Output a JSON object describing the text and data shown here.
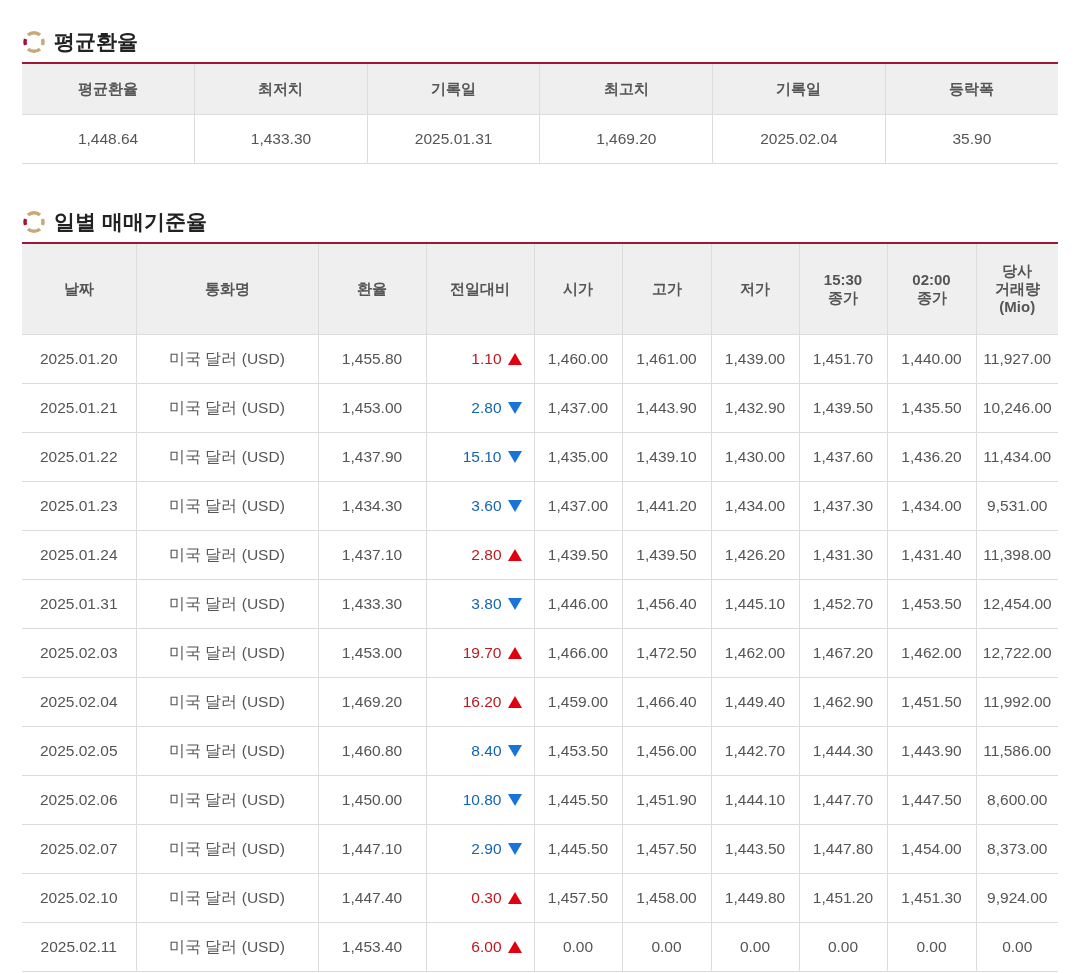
{
  "average_section": {
    "title": "평균환율",
    "columns": [
      "평균환율",
      "최저치",
      "기록일",
      "최고치",
      "기록일",
      "등락폭"
    ],
    "values": [
      "1,448.64",
      "1,433.30",
      "2025.01.31",
      "1,469.20",
      "2025.02.04",
      "35.90"
    ]
  },
  "daily_section": {
    "title": "일별 매매기준율",
    "columns": [
      "날짜",
      "통화명",
      "환율",
      "전일대비",
      "시가",
      "고가",
      "저가",
      "15:30\n종가",
      "02:00\n종가",
      "당사\n거래량\n(Mio)"
    ],
    "rows": [
      {
        "date": "2025.01.20",
        "currency": "미국 달러 (USD)",
        "rate": "1,455.80",
        "change": "1.10",
        "rising": true,
        "open": "1,460.00",
        "high": "1,461.00",
        "low": "1,439.00",
        "close_1530": "1,451.70",
        "close_0200": "1,440.00",
        "volume": "11,927.00"
      },
      {
        "date": "2025.01.21",
        "currency": "미국 달러 (USD)",
        "rate": "1,453.00",
        "change": "2.80",
        "rising": false,
        "open": "1,437.00",
        "high": "1,443.90",
        "low": "1,432.90",
        "close_1530": "1,439.50",
        "close_0200": "1,435.50",
        "volume": "10,246.00"
      },
      {
        "date": "2025.01.22",
        "currency": "미국 달러 (USD)",
        "rate": "1,437.90",
        "change": "15.10",
        "rising": false,
        "open": "1,435.00",
        "high": "1,439.10",
        "low": "1,430.00",
        "close_1530": "1,437.60",
        "close_0200": "1,436.20",
        "volume": "11,434.00"
      },
      {
        "date": "2025.01.23",
        "currency": "미국 달러 (USD)",
        "rate": "1,434.30",
        "change": "3.60",
        "rising": false,
        "open": "1,437.00",
        "high": "1,441.20",
        "low": "1,434.00",
        "close_1530": "1,437.30",
        "close_0200": "1,434.00",
        "volume": "9,531.00"
      },
      {
        "date": "2025.01.24",
        "currency": "미국 달러 (USD)",
        "rate": "1,437.10",
        "change": "2.80",
        "rising": true,
        "open": "1,439.50",
        "high": "1,439.50",
        "low": "1,426.20",
        "close_1530": "1,431.30",
        "close_0200": "1,431.40",
        "volume": "11,398.00"
      },
      {
        "date": "2025.01.31",
        "currency": "미국 달러 (USD)",
        "rate": "1,433.30",
        "change": "3.80",
        "rising": false,
        "open": "1,446.00",
        "high": "1,456.40",
        "low": "1,445.10",
        "close_1530": "1,452.70",
        "close_0200": "1,453.50",
        "volume": "12,454.00"
      },
      {
        "date": "2025.02.03",
        "currency": "미국 달러 (USD)",
        "rate": "1,453.00",
        "change": "19.70",
        "rising": true,
        "open": "1,466.00",
        "high": "1,472.50",
        "low": "1,462.00",
        "close_1530": "1,467.20",
        "close_0200": "1,462.00",
        "volume": "12,722.00"
      },
      {
        "date": "2025.02.04",
        "currency": "미국 달러 (USD)",
        "rate": "1,469.20",
        "change": "16.20",
        "rising": true,
        "open": "1,459.00",
        "high": "1,466.40",
        "low": "1,449.40",
        "close_1530": "1,462.90",
        "close_0200": "1,451.50",
        "volume": "11,992.00"
      },
      {
        "date": "2025.02.05",
        "currency": "미국 달러 (USD)",
        "rate": "1,460.80",
        "change": "8.40",
        "rising": false,
        "open": "1,453.50",
        "high": "1,456.00",
        "low": "1,442.70",
        "close_1530": "1,444.30",
        "close_0200": "1,443.90",
        "volume": "11,586.00"
      },
      {
        "date": "2025.02.06",
        "currency": "미국 달러 (USD)",
        "rate": "1,450.00",
        "change": "10.80",
        "rising": false,
        "open": "1,445.50",
        "high": "1,451.90",
        "low": "1,444.10",
        "close_1530": "1,447.70",
        "close_0200": "1,447.50",
        "volume": "8,600.00"
      },
      {
        "date": "2025.02.07",
        "currency": "미국 달러 (USD)",
        "rate": "1,447.10",
        "change": "2.90",
        "rising": false,
        "open": "1,445.50",
        "high": "1,457.50",
        "low": "1,443.50",
        "close_1530": "1,447.80",
        "close_0200": "1,454.00",
        "volume": "8,373.00"
      },
      {
        "date": "2025.02.10",
        "currency": "미국 달러 (USD)",
        "rate": "1,447.40",
        "change": "0.30",
        "rising": true,
        "open": "1,457.50",
        "high": "1,458.00",
        "low": "1,449.80",
        "close_1530": "1,451.20",
        "close_0200": "1,451.30",
        "volume": "9,924.00"
      },
      {
        "date": "2025.02.11",
        "currency": "미국 달러 (USD)",
        "rate": "1,453.40",
        "change": "6.00",
        "rising": true,
        "open": "0.00",
        "high": "0.00",
        "low": "0.00",
        "close_1530": "0.00",
        "close_0200": "0.00",
        "volume": "0.00"
      }
    ]
  }
}
